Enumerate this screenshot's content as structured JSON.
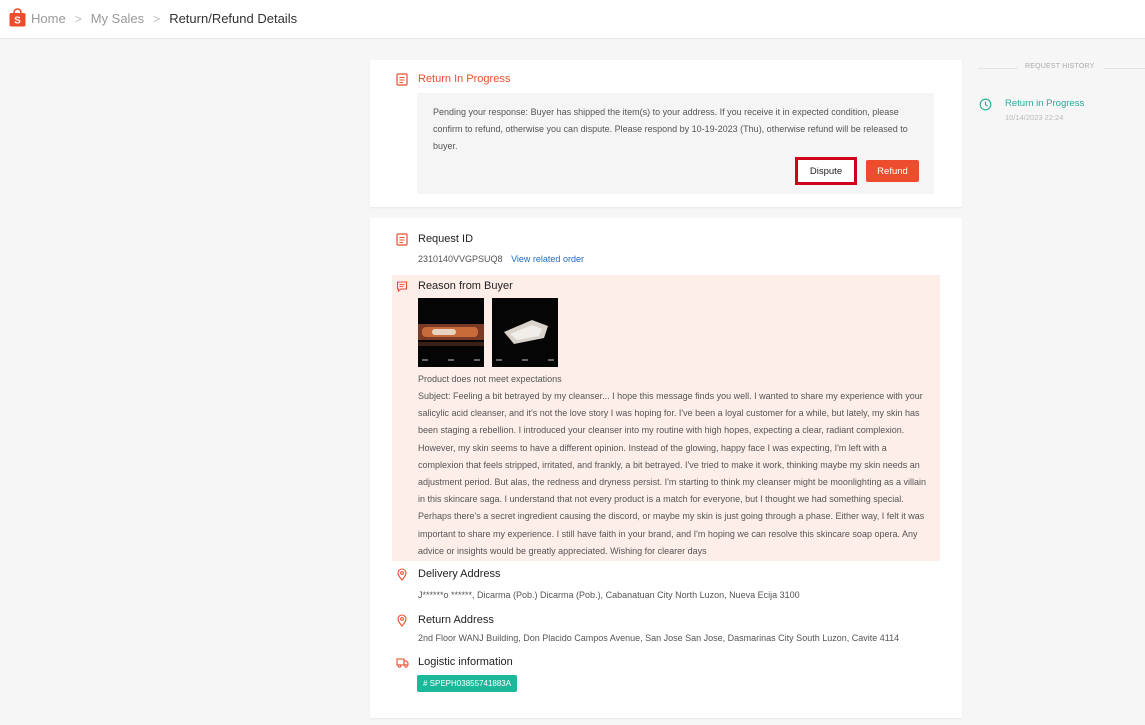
{
  "breadcrumb": {
    "home": "Home",
    "my_sales": "My Sales",
    "current": "Return/Refund Details",
    "separator": ">"
  },
  "status_card": {
    "title": "Return In Progress",
    "message": "Pending your response: Buyer has shipped the item(s) to your address. If you receive it in expected condition, please confirm to refund, otherwise you can dispute. Please respond by 10-19-2023 (Thu), otherwise refund will be released to buyer.",
    "dispute_label": "Dispute",
    "refund_label": "Refund"
  },
  "details": {
    "request_id_title": "Request ID",
    "request_id": "2310140VVGPSUQ8",
    "view_order_link": "View related order",
    "reason_title": "Reason from Buyer",
    "reason_summary": "Product does not meet expectations",
    "reason_body": "Subject: Feeling a bit betrayed by my cleanser... I hope this message finds you well. I wanted to share my experience with your salicylic acid cleanser, and it's not the love story I was hoping for. I've been a loyal customer for a while, but lately, my skin has been staging a rebellion. I introduced your cleanser into my routine with high hopes, expecting a clear, radiant complexion. However, my skin seems to have a different opinion. Instead of the glowing, happy face I was expecting, I'm left with a complexion that feels stripped, irritated, and frankly, a bit betrayed. I've tried to make it work, thinking maybe my skin needs an adjustment period. But alas, the redness and dryness persist. I'm starting to think my cleanser might be moonlighting as a villain in this skincare saga. I understand that not every product is a match for everyone, but I thought we had something special. Perhaps there's a secret ingredient causing the discord, or maybe my skin is just going through a phase. Either way, I felt it was important to share my experience. I still have faith in your brand, and I'm hoping we can resolve this skincare soap opera. Any advice or insights would be greatly appreciated. Wishing for clearer days",
    "delivery_title": "Delivery Address",
    "delivery_address": "J******o ******, Dicarma (Pob.) Dicarma (Pob.), Cabanatuan City North Luzon, Nueva Ecija 3100",
    "return_title": "Return Address",
    "return_address": "2nd Floor WANJ Building, Don Placido Campos Avenue, San Jose San Jose, Dasmarinas City South Luzon, Cavite 4114",
    "logistic_title": "Logistic information",
    "tracking_number": "# SPEPH03855741883A"
  },
  "history": {
    "title": "REQUEST HISTORY",
    "items": [
      {
        "status": "Return in Progress",
        "time": "10/14/2023 22:24"
      }
    ]
  },
  "colors": {
    "brand": "#ee4d2d",
    "teal": "#26aa99",
    "dispute_highlight": "#d0021b"
  }
}
